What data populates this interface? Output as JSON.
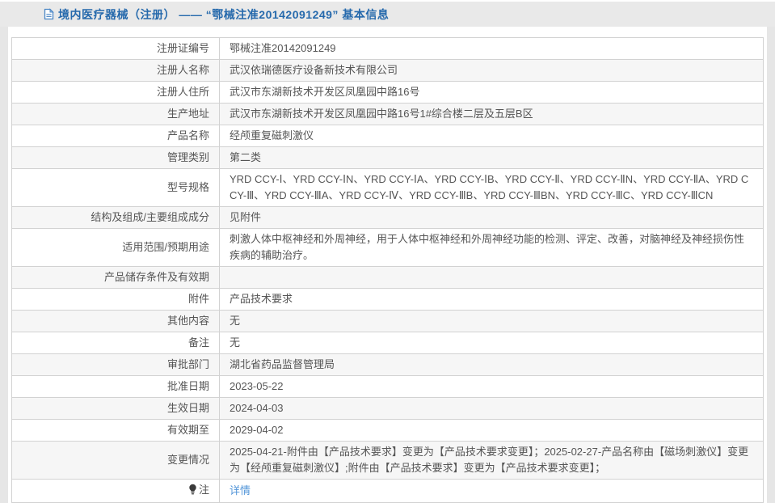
{
  "page": {
    "title": "境内医疗器械（注册） —— “鄂械注准20142091249” 基本信息",
    "colors": {
      "title_blue": "#2569ac",
      "link_blue": "#5094d8",
      "titlebar_bg": "#e9e9e9",
      "row_alt_bg": "#f6f6f6",
      "border": "#d2d2d2",
      "text": "#555555",
      "side_margin": "#e6e6e6"
    },
    "icons": {
      "header": "document-icon",
      "note": "lightbulb-icon"
    }
  },
  "table": {
    "rows": [
      {
        "label": "注册证编号",
        "value": "鄂械注准20142091249"
      },
      {
        "label": "注册人名称",
        "value": "武汉依瑞德医疗设备新技术有限公司"
      },
      {
        "label": "注册人住所",
        "value": "武汉市东湖新技术开发区凤凰园中路16号"
      },
      {
        "label": "生产地址",
        "value": "武汉市东湖新技术开发区凤凰园中路16号1#综合楼二层及五层B区"
      },
      {
        "label": "产品名称",
        "value": "经颅重复磁刺激仪"
      },
      {
        "label": "管理类别",
        "value": "第二类"
      },
      {
        "label": "型号规格",
        "value": "YRD CCY-Ⅰ、YRD CCY-ⅠN、YRD CCY-ⅠA、YRD CCY-ⅠB、YRD CCY-Ⅱ、YRD CCY-ⅡN、YRD CCY-ⅡA、YRD CCY-Ⅲ、YRD CCY-ⅢA、YRD CCY-Ⅳ、YRD CCY-ⅢB、YRD CCY-ⅢBN、YRD CCY-ⅢC、YRD CCY-ⅢCN"
      },
      {
        "label": "结构及组成/主要组成成分",
        "value": "见附件"
      },
      {
        "label": "适用范围/预期用途",
        "value": "刺激人体中枢神经和外周神经，用于人体中枢神经和外周神经功能的检测、评定、改善，对脑神经及神经损伤性疾病的辅助治疗。"
      },
      {
        "label": "产品储存条件及有效期",
        "value": ""
      },
      {
        "label": "附件",
        "value": "产品技术要求"
      },
      {
        "label": "其他内容",
        "value": "无"
      },
      {
        "label": "备注",
        "value": "无"
      },
      {
        "label": "审批部门",
        "value": "湖北省药品监督管理局"
      },
      {
        "label": "批准日期",
        "value": "2023-05-22"
      },
      {
        "label": "生效日期",
        "value": "2024-04-03"
      },
      {
        "label": "有效期至",
        "value": "2029-04-02"
      },
      {
        "label": "变更情况",
        "value": "2025-04-21-附件由【产品技术要求】变更为【产品技术要求变更】；2025-02-27-产品名称由【磁场刺激仪】变更为【经颅重复磁刺激仪】;附件由【产品技术要求】变更为【产品技术要求变更】；"
      },
      {
        "label": "注",
        "value": "详情",
        "note_icon": true,
        "link": true
      }
    ]
  }
}
